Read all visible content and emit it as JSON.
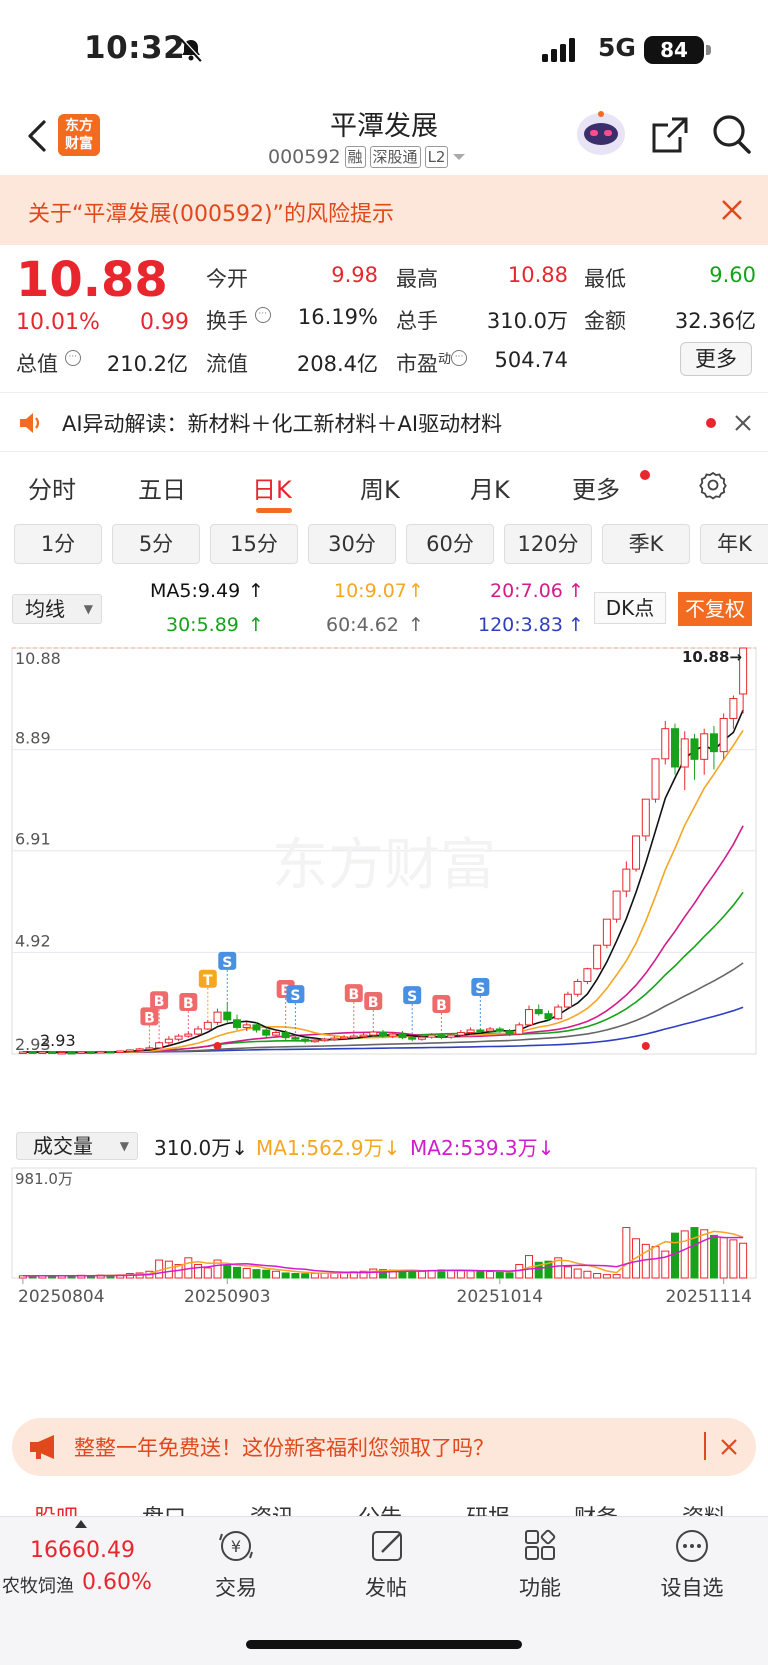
{
  "status_bar": {
    "time": "10:32",
    "network": "5G",
    "battery": "84"
  },
  "header": {
    "logo_line1": "东方",
    "logo_line2": "财富",
    "stock_name": "平潭发展",
    "stock_code": "000592",
    "tags": [
      "融",
      "深股通",
      "L2"
    ]
  },
  "risk_banner": {
    "text": "关于“平潭发展(000592)”的风险提示"
  },
  "quote": {
    "price": "10.88",
    "change_pct": "10.01%",
    "change": "0.99",
    "fields": [
      {
        "label": "今开",
        "value": "9.98",
        "color": "red"
      },
      {
        "label": "最高",
        "value": "10.88",
        "color": "red"
      },
      {
        "label": "最低",
        "value": "9.60",
        "color": "green"
      },
      {
        "label": "换手",
        "value": "16.19%",
        "color": "dark"
      },
      {
        "label": "总手",
        "value": "310.0万",
        "color": "dark"
      },
      {
        "label": "金额",
        "value": "32.36亿",
        "color": "dark"
      },
      {
        "label": "总值",
        "value": "210.2亿",
        "color": "dark"
      },
      {
        "label": "流值",
        "value": "208.4亿",
        "color": "dark"
      },
      {
        "label": "市盈",
        "sup": "动",
        "value": "504.74",
        "color": "dark"
      }
    ],
    "more_label": "更多"
  },
  "ai_row": {
    "label": "AI异动解读：",
    "text": "新材料＋化工新材料＋AI驱动材料"
  },
  "period_tabs": [
    "分时",
    "五日",
    "日K",
    "周K",
    "月K",
    "更多"
  ],
  "active_period": "日K",
  "minute_buttons": [
    "1分",
    "5分",
    "15分",
    "30分",
    "60分",
    "120分",
    "季K",
    "年K"
  ],
  "ma_row": {
    "select": "均线",
    "ma5": "MA5:9.49",
    "ma10": "10:9.07",
    "ma20": "20:7.06",
    "ma30": "30:5.89",
    "ma60": "60:4.62",
    "ma120": "120:3.83",
    "dk_label": "DK点",
    "adjust_label": "不复权"
  },
  "colors": {
    "up": "#e8262d",
    "down": "#16a31a",
    "ma5": "#111111",
    "ma10": "#f5a623",
    "ma20": "#d21c8a",
    "ma30": "#16a31a",
    "ma60": "#666666",
    "ma120": "#2f3fc0",
    "accent": "#f26b21"
  },
  "volume_row": {
    "select": "成交量",
    "volume": "310.0万",
    "ma1": "MA1:562.9万",
    "ma2": "MA2:539.3万"
  },
  "chart_data": [
    {
      "type": "candlestick",
      "y_ticks": [
        "10.88",
        "8.89",
        "6.91",
        "4.92",
        "2.93"
      ],
      "ylim": [
        2.93,
        10.88
      ],
      "last_price_label": "10.88",
      "low_marker": "2.93",
      "signal_markers": [
        "B",
        "B",
        "B",
        "T",
        "S",
        "B",
        "S",
        "B",
        "B",
        "S",
        "B",
        "S"
      ],
      "candles": [
        [
          2.96,
          2.97,
          2.95,
          2.98
        ],
        [
          2.97,
          2.96,
          2.95,
          2.98
        ],
        [
          2.96,
          2.97,
          2.95,
          2.98
        ],
        [
          2.97,
          2.95,
          2.94,
          2.98
        ],
        [
          2.95,
          2.96,
          2.94,
          2.97
        ],
        [
          2.96,
          2.95,
          2.93,
          2.97
        ],
        [
          2.95,
          2.97,
          2.94,
          2.98
        ],
        [
          2.97,
          2.96,
          2.95,
          2.98
        ],
        [
          2.96,
          2.98,
          2.95,
          2.99
        ],
        [
          2.98,
          2.97,
          2.96,
          2.99
        ],
        [
          2.97,
          2.99,
          2.96,
          3.0
        ],
        [
          2.99,
          3.01,
          2.98,
          3.02
        ],
        [
          3.01,
          3.03,
          3.0,
          3.05
        ],
        [
          3.03,
          3.05,
          3.02,
          3.1
        ],
        [
          3.05,
          3.15,
          3.04,
          3.18
        ],
        [
          3.15,
          3.22,
          3.1,
          3.28
        ],
        [
          3.22,
          3.28,
          3.18,
          3.32
        ],
        [
          3.28,
          3.32,
          3.25,
          3.38
        ],
        [
          3.32,
          3.42,
          3.3,
          3.48
        ],
        [
          3.42,
          3.55,
          3.4,
          3.6
        ],
        [
          3.55,
          3.75,
          3.5,
          3.82
        ],
        [
          3.75,
          3.6,
          3.55,
          3.95
        ],
        [
          3.6,
          3.45,
          3.4,
          3.7
        ],
        [
          3.45,
          3.5,
          3.38,
          3.55
        ],
        [
          3.5,
          3.4,
          3.35,
          3.55
        ],
        [
          3.4,
          3.3,
          3.25,
          3.45
        ],
        [
          3.3,
          3.35,
          3.25,
          3.4
        ],
        [
          3.35,
          3.25,
          3.2,
          3.4
        ],
        [
          3.25,
          3.22,
          3.18,
          3.3
        ],
        [
          3.22,
          3.18,
          3.14,
          3.26
        ],
        [
          3.18,
          3.2,
          3.15,
          3.24
        ],
        [
          3.2,
          3.22,
          3.17,
          3.25
        ],
        [
          3.22,
          3.24,
          3.19,
          3.28
        ],
        [
          3.24,
          3.26,
          3.21,
          3.3
        ],
        [
          3.26,
          3.28,
          3.23,
          3.32
        ],
        [
          3.28,
          3.3,
          3.25,
          3.35
        ],
        [
          3.3,
          3.36,
          3.27,
          3.4
        ],
        [
          3.36,
          3.28,
          3.25,
          3.4
        ],
        [
          3.28,
          3.32,
          3.24,
          3.36
        ],
        [
          3.32,
          3.25,
          3.22,
          3.38
        ],
        [
          3.25,
          3.22,
          3.18,
          3.28
        ],
        [
          3.22,
          3.26,
          3.19,
          3.3
        ],
        [
          3.26,
          3.3,
          3.23,
          3.34
        ],
        [
          3.3,
          3.26,
          3.22,
          3.34
        ],
        [
          3.26,
          3.3,
          3.23,
          3.34
        ],
        [
          3.3,
          3.35,
          3.27,
          3.4
        ],
        [
          3.35,
          3.4,
          3.32,
          3.45
        ],
        [
          3.4,
          3.38,
          3.34,
          3.44
        ],
        [
          3.38,
          3.42,
          3.35,
          3.46
        ],
        [
          3.42,
          3.38,
          3.35,
          3.46
        ],
        [
          3.38,
          3.32,
          3.28,
          3.42
        ],
        [
          3.32,
          3.5,
          3.3,
          3.55
        ],
        [
          3.5,
          3.8,
          3.48,
          3.88
        ],
        [
          3.8,
          3.72,
          3.68,
          3.9
        ],
        [
          3.72,
          3.62,
          3.58,
          3.78
        ],
        [
          3.62,
          3.85,
          3.6,
          3.9
        ],
        [
          3.85,
          4.1,
          3.82,
          4.15
        ],
        [
          4.1,
          4.35,
          4.05,
          4.4
        ],
        [
          4.35,
          4.6,
          4.3,
          4.62
        ],
        [
          4.6,
          5.06,
          4.58,
          5.06
        ],
        [
          5.06,
          5.57,
          5.0,
          5.57
        ],
        [
          5.57,
          6.12,
          5.5,
          6.13
        ],
        [
          6.12,
          6.55,
          6.0,
          6.7
        ],
        [
          6.55,
          7.2,
          6.5,
          7.2
        ],
        [
          7.2,
          7.92,
          7.1,
          7.92
        ],
        [
          7.92,
          8.71,
          7.85,
          8.71
        ],
        [
          8.71,
          9.3,
          8.6,
          9.45
        ],
        [
          9.3,
          8.55,
          8.4,
          9.4
        ],
        [
          8.55,
          9.1,
          8.1,
          9.25
        ],
        [
          9.1,
          8.7,
          8.3,
          9.2
        ],
        [
          8.7,
          9.2,
          8.4,
          9.3
        ],
        [
          9.2,
          8.85,
          8.5,
          9.35
        ],
        [
          8.85,
          9.5,
          8.7,
          9.6
        ],
        [
          9.5,
          9.89,
          9.3,
          9.95
        ],
        [
          9.98,
          10.88,
          9.6,
          10.88
        ]
      ],
      "volumes": [
        20,
        18,
        22,
        19,
        18,
        20,
        24,
        22,
        26,
        24,
        28,
        40,
        45,
        60,
        160,
        150,
        120,
        180,
        120,
        90,
        160,
        110,
        95,
        85,
        75,
        70,
        60,
        45,
        40,
        38,
        42,
        45,
        48,
        52,
        55,
        60,
        80,
        75,
        70,
        65,
        62,
        60,
        68,
        72,
        70,
        65,
        62,
        60,
        58,
        55,
        45,
        120,
        200,
        140,
        150,
        180,
        100,
        80,
        60,
        40,
        30,
        30,
        450,
        350,
        300,
        280,
        240,
        400,
        420,
        450,
        430,
        380,
        360,
        340,
        310
      ],
      "volume_max_label": "981.0万",
      "x_labels": [
        "20250804",
        "20250903",
        "20251014",
        "20251114"
      ]
    }
  ],
  "promo": {
    "text": "整整一年免费送！这份新客福利您领取了吗？"
  },
  "sub_tabs": [
    "股吧",
    "盘口",
    "资讯",
    "公告",
    "研报",
    "财务",
    "资料"
  ],
  "bottom_bar": {
    "index_value": "16660.49",
    "index_name": "农牧饲渔",
    "index_pct": "0.60%",
    "items": [
      "交易",
      "发帖",
      "功能",
      "设自选"
    ]
  }
}
